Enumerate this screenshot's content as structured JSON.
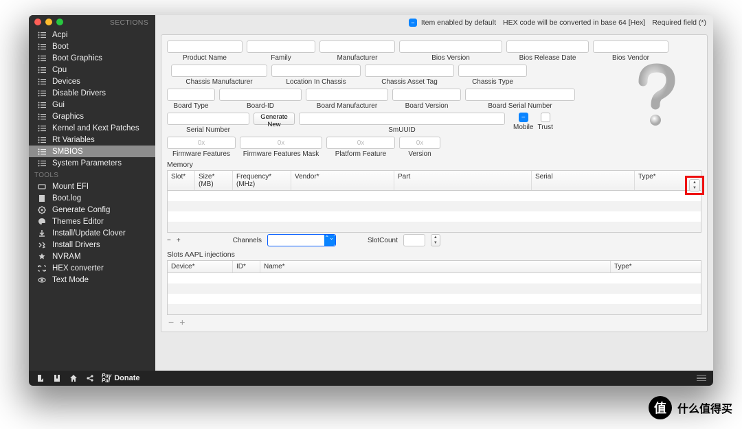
{
  "sidebar": {
    "header": "SECTIONS",
    "sections": [
      "Acpi",
      "Boot",
      "Boot Graphics",
      "Cpu",
      "Devices",
      "Disable Drivers",
      "Gui",
      "Graphics",
      "Kernel and Kext Patches",
      "Rt Variables",
      "SMBIOS",
      "System Parameters"
    ],
    "tools_header": "TOOLS",
    "tools": [
      "Mount EFI",
      "Boot.log",
      "Generate Config",
      "Themes Editor",
      "Install/Update Clover",
      "Install Drivers",
      "NVRAM",
      "HEX converter",
      "Text Mode"
    ],
    "selected": "SMBIOS"
  },
  "footer": {
    "donate": "Donate"
  },
  "topbar": {
    "enabled_default": "Item enabled by default",
    "hex_note": "HEX code will be converted in base 64 [Hex]",
    "required": "Required field (*)"
  },
  "fields": {
    "row1": [
      "Product Name",
      "Family",
      "Manufacturer",
      "Bios Version",
      "Bios Release Date",
      "Bios Vendor"
    ],
    "row2": [
      "Chassis Manufacturer",
      "Location In Chassis",
      "Chassis  Asset Tag",
      "Chassis Type"
    ],
    "row3": [
      "Board Type",
      "Board-ID",
      "Board Manufacturer",
      "Board Version",
      "Board Serial Number"
    ],
    "row4_serial": "Serial Number",
    "row4_gen": "Generate New",
    "row4_smuuid": "SmUUID",
    "row4_mobile": "Mobile",
    "row4_trust": "Trust",
    "row5": [
      "Firmware Features",
      "Firmware Features Mask",
      "Platform Feature",
      "Version"
    ],
    "hex_ph": "0x"
  },
  "memory": {
    "title": "Memory",
    "cols": [
      "Slot*",
      "Size* (MB)",
      "Frequency* (MHz)",
      "Vendor*",
      "Part",
      "Serial",
      "Type*"
    ],
    "channels_lbl": "Channels",
    "slotcount_lbl": "SlotCount"
  },
  "slots": {
    "title": "Slots AAPL injections",
    "cols": [
      "Device*",
      "ID*",
      "Name*",
      "Type*"
    ]
  },
  "corner": {
    "brand": "什么值得买",
    "glyph": "值"
  }
}
